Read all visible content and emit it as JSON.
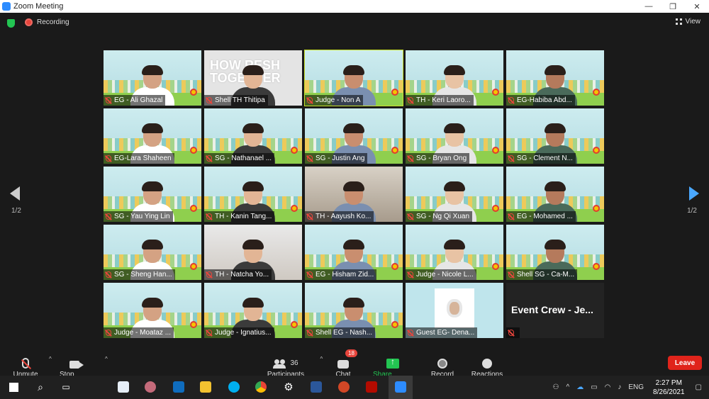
{
  "window": {
    "title": "Zoom Meeting",
    "controls": [
      "—",
      "❐",
      "✕"
    ]
  },
  "topbar": {
    "recording_label": "Recording",
    "view_label": "View"
  },
  "pagination": {
    "left": "1/2",
    "right": "1/2"
  },
  "tiles": [
    {
      "name": "EG - Ali Ghazal",
      "kind": "bg"
    },
    {
      "name": "Shell TH Thitipa",
      "kind": "banner",
      "banner": "HOW RESH TOGETHER"
    },
    {
      "name": "Judge - Non A",
      "kind": "bg",
      "active": true
    },
    {
      "name": "TH - Keri Laoro...",
      "kind": "bg"
    },
    {
      "name": "EG-Habiba Abd...",
      "kind": "bg"
    },
    {
      "name": "EG-Lara Shaheen",
      "kind": "bg"
    },
    {
      "name": "SG - Nathanael ...",
      "kind": "bg"
    },
    {
      "name": "SG - Justin Ang",
      "kind": "bg"
    },
    {
      "name": "SG - Bryan Ong",
      "kind": "bg"
    },
    {
      "name": "SG - Clement N...",
      "kind": "bg"
    },
    {
      "name": "SG - Yau Ying Lin",
      "kind": "bg"
    },
    {
      "name": "TH - Kanin Tang...",
      "kind": "bg"
    },
    {
      "name": "TH - Aayush Ko...",
      "kind": "room"
    },
    {
      "name": "SG - Ng Qi Xuan",
      "kind": "bg"
    },
    {
      "name": "EG - Mohamed ...",
      "kind": "bg"
    },
    {
      "name": "SG - Sheng Han...",
      "kind": "bg"
    },
    {
      "name": "TH - Natcha Yo...",
      "kind": "office"
    },
    {
      "name": "EG - Hisham Zid...",
      "kind": "bg"
    },
    {
      "name": "Judge - Nicole L...",
      "kind": "bg"
    },
    {
      "name": "Shell SG - Ca-M...",
      "kind": "bg"
    },
    {
      "name": "Judge - Moataz ...",
      "kind": "bg"
    },
    {
      "name": "Judge - Ignatius...",
      "kind": "bg"
    },
    {
      "name": "Shell EG - Nash...",
      "kind": "bg"
    },
    {
      "name": "Guest EG- Dena...",
      "kind": "photo"
    },
    {
      "name": "",
      "kind": "dark",
      "crew": "Event Crew - Je..."
    }
  ],
  "controls": {
    "unmute": "Unmute",
    "stop_video": "Stop Video",
    "participants": "Participants",
    "participants_count": "36",
    "chat": "Chat",
    "chat_badge": "18",
    "share_screen": "Share Screen",
    "record": "Record",
    "reactions": "Reactions",
    "leave": "Leave"
  },
  "taskbar": {
    "language": "ENG",
    "time": "2:27 PM",
    "date": "8/26/2021"
  }
}
